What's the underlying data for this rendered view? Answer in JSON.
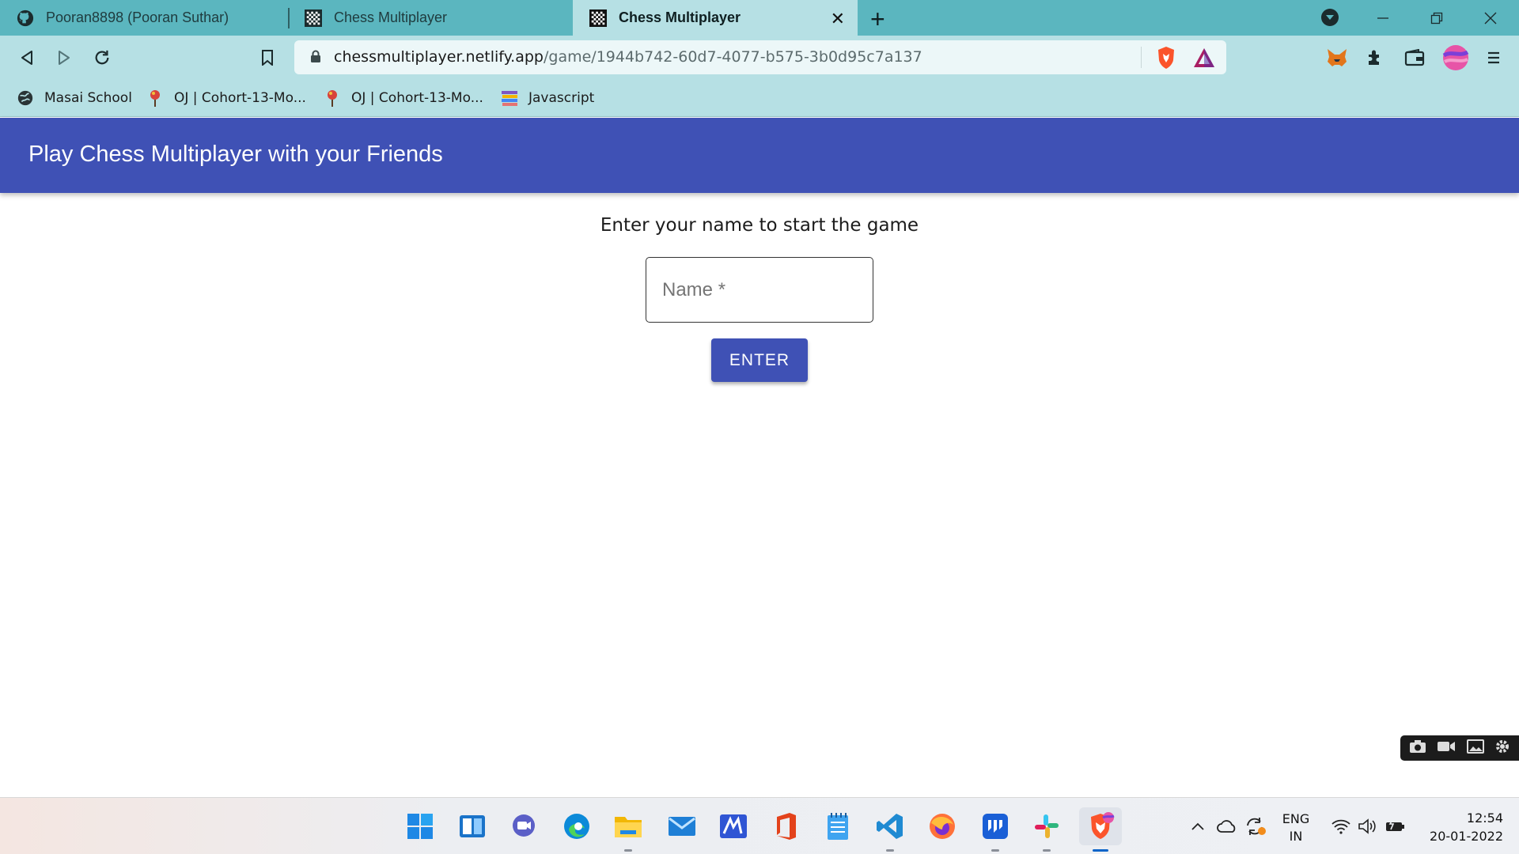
{
  "browser": {
    "tabs": [
      {
        "label": "Pooran8898 (Pooran Suthar)",
        "icon": "github-icon"
      },
      {
        "label": "Chess Multiplayer",
        "icon": "chess-icon"
      },
      {
        "label": "Chess Multiplayer",
        "icon": "chess-icon",
        "active": true
      }
    ],
    "url_host": "chessmultiplayer.netlify.app",
    "url_path": "/game/1944b742-60d7-4077-b575-3b0d95c7a137",
    "bookmarks": [
      {
        "label": "Masai School",
        "icon": "globe-icon"
      },
      {
        "label": "OJ | Cohort-13-Mo...",
        "icon": "pin-icon"
      },
      {
        "label": "OJ | Cohort-13-Mo...",
        "icon": "pin-icon"
      },
      {
        "label": "Javascript",
        "icon": "book-stack-icon"
      }
    ]
  },
  "app": {
    "title": "Play Chess Multiplayer with your Friends",
    "prompt": "Enter your name to start the game",
    "name_placeholder": "Name *",
    "enter_label": "ENTER",
    "primary_color": "#3f51b5"
  },
  "taskbar": {
    "lang_line1": "ENG",
    "lang_line2": "IN",
    "time": "12:54",
    "date": "20-01-2022"
  }
}
